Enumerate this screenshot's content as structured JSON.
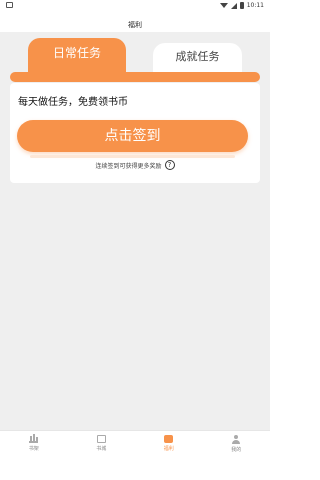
{
  "status_bar": {
    "time": "10:11"
  },
  "header": {
    "title": "福利"
  },
  "tabs": {
    "daily_label": "日常任务",
    "achievement_label": "成就任务"
  },
  "task_card": {
    "headline": "每天做任务，免费领书币",
    "signin_label": "点击签到",
    "hint": "连续签到可获得更多奖励",
    "hint_icon": "?"
  },
  "bottom_nav": {
    "items": [
      {
        "label": "书架",
        "icon": "bookshelf-icon"
      },
      {
        "label": "书城",
        "icon": "bookstore-icon"
      },
      {
        "label": "福利",
        "icon": "gift-icon",
        "active": true
      },
      {
        "label": "我的",
        "icon": "profile-icon"
      }
    ]
  },
  "colors": {
    "accent": "#f7924a",
    "background": "#efefef"
  }
}
